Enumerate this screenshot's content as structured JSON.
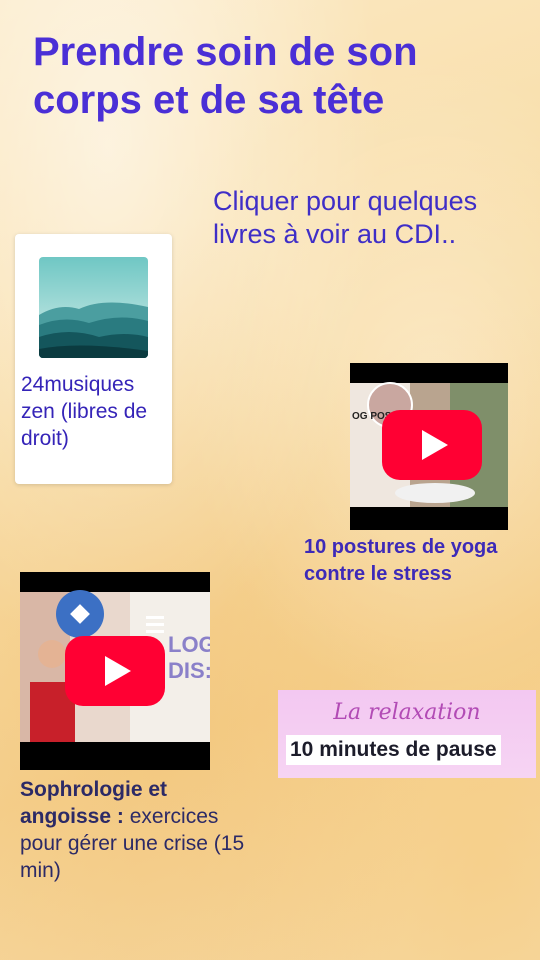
{
  "page": {
    "title": "Prendre soin de son corps et de sa tête",
    "cta": "Cliquer pour quelques livres à voir au CDI.."
  },
  "music_card": {
    "label": "24musiques zen (libres de droit)",
    "icon": "mountains-thumbnail"
  },
  "yoga_video": {
    "caption": "10 postures de yoga contre le stress",
    "thumb_text": "OG POST",
    "icon": "youtube-play-icon"
  },
  "sophro_video": {
    "caption_bold": "Sophrologie et angoisse :",
    "caption_rest": " exercices pour gérer une crise (15 min)",
    "thumb_text": "LOG DIS:",
    "icon": "youtube-play-icon"
  },
  "pause_card": {
    "script_title": "La relaxation",
    "label": "10 minutes de pause"
  },
  "colors": {
    "title": "#4a2fd6",
    "youtube_red": "#ff0033",
    "pause_bg": "#f3c8f2"
  }
}
